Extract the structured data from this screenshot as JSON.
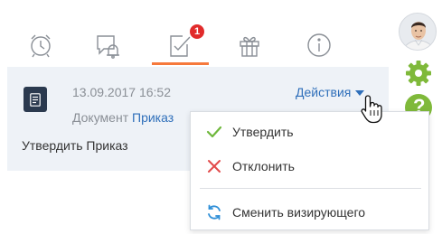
{
  "tabs": [
    {
      "icon": "alarm-clock-icon"
    },
    {
      "icon": "chat-bell-icon"
    },
    {
      "icon": "approval-check-icon",
      "badge": "1",
      "active": true
    },
    {
      "icon": "gift-icon"
    },
    {
      "icon": "info-icon"
    }
  ],
  "accent_color": "#f6793c",
  "badge_color": "#e12b2b",
  "card": {
    "date": "13.09.2017 16:52",
    "type_label": "Документ",
    "type_link": "Приказ",
    "title": "Утвердить Приказ",
    "actions_label": "Действия"
  },
  "menu": {
    "items": [
      {
        "label": "Утвердить",
        "icon": "check-icon",
        "color": "#6fb83c"
      },
      {
        "label": "Отклонить",
        "icon": "x-icon",
        "color": "#e24b4b"
      },
      {
        "label": "Сменить визирующего",
        "icon": "refresh-icon",
        "color": "#2f8fd8"
      }
    ]
  },
  "sidebar": {
    "avatar": "user-avatar",
    "settings_icon": "gear-icon",
    "help_icon": "help-icon",
    "help_glyph": "?"
  }
}
